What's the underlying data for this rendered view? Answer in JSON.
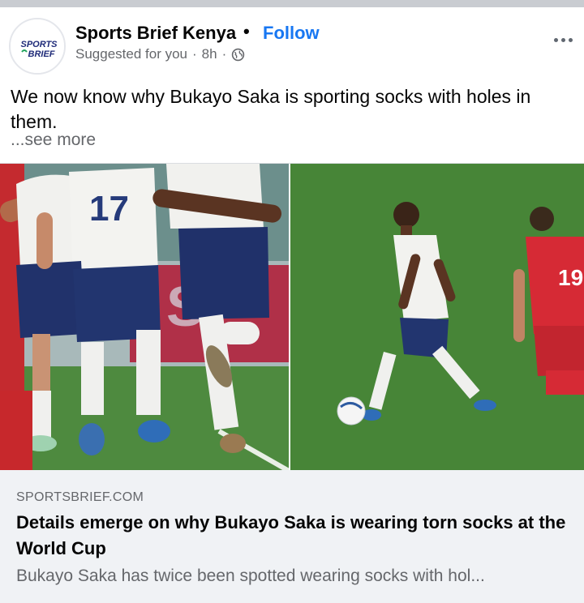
{
  "post": {
    "page_name": "Sports Brief Kenya",
    "separator": "•",
    "follow_label": "Follow",
    "suggested": "Suggested for you",
    "meta_dot": "·",
    "time": "8h",
    "text": "We now know why Bukayo Saka is sporting socks with holes in them.",
    "see_more": "...see more",
    "avatar_logo_line1": "SPORTS",
    "avatar_logo_line2": "BRIEF"
  },
  "images": {
    "left_icon": "soccer-players-feet-photo",
    "right_icon": "bukayo-saka-dribbling-photo",
    "left_shirt_number": "17",
    "right_opponent_number": "19"
  },
  "link_preview": {
    "domain": "SPORTSBRIEF.COM",
    "headline": "Details emerge on why Bukayo Saka is wearing torn socks at the World Cup",
    "description": "Bukayo Saka has twice been spotted wearing socks with hol..."
  },
  "colors": {
    "accent": "#1877f2",
    "secondary_text": "#65676b",
    "link_bg": "#f0f2f5",
    "pitch_green": "#4c8a3a"
  }
}
